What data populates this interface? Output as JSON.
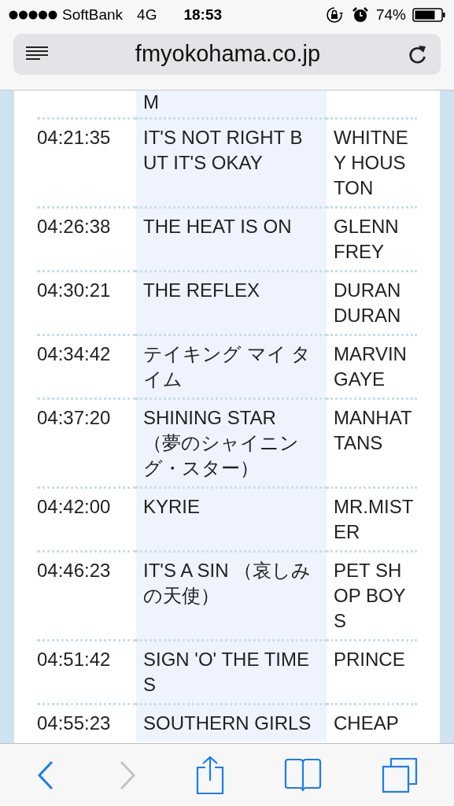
{
  "status_bar": {
    "carrier": "SoftBank",
    "network": "4G",
    "time": "18:53",
    "battery": "74%"
  },
  "address_bar": {
    "url": "fmyokohama.co.jp"
  },
  "playlist": [
    {
      "kind": "fragment",
      "title": "M"
    },
    {
      "kind": "track",
      "time": "04:21:35",
      "title": "IT'S NOT RIGHT BUT IT'S OKAY",
      "artist": "WHITNEY HOUSTON"
    },
    {
      "kind": "track",
      "time": "04:26:38",
      "title": "THE HEAT IS ON",
      "artist": "GLENN FREY"
    },
    {
      "kind": "track",
      "time": "04:30:21",
      "title": "THE REFLEX",
      "artist": "DURAN DURAN"
    },
    {
      "kind": "track",
      "time": "04:34:42",
      "title": "テイキング マイ タイム",
      "artist": "MARVIN GAYE"
    },
    {
      "kind": "track",
      "time": "04:37:20",
      "title": "SHINING STAR （夢のシャイニング・スター）",
      "artist": "MANHATTANS"
    },
    {
      "kind": "track",
      "time": "04:42:00",
      "title": "KYRIE",
      "artist": "MR.MISTER"
    },
    {
      "kind": "track",
      "time": "04:46:23",
      "title": "IT'S A SIN （哀しみの天使）",
      "artist": "PET SHOP BOYS"
    },
    {
      "kind": "track",
      "time": "04:51:42",
      "title": "SIGN 'O' THE TIMES",
      "artist": "PRINCE"
    },
    {
      "kind": "track",
      "time": "04:55:23",
      "title": "SOUTHERN GIRLS",
      "artist": "CHEAP"
    }
  ]
}
